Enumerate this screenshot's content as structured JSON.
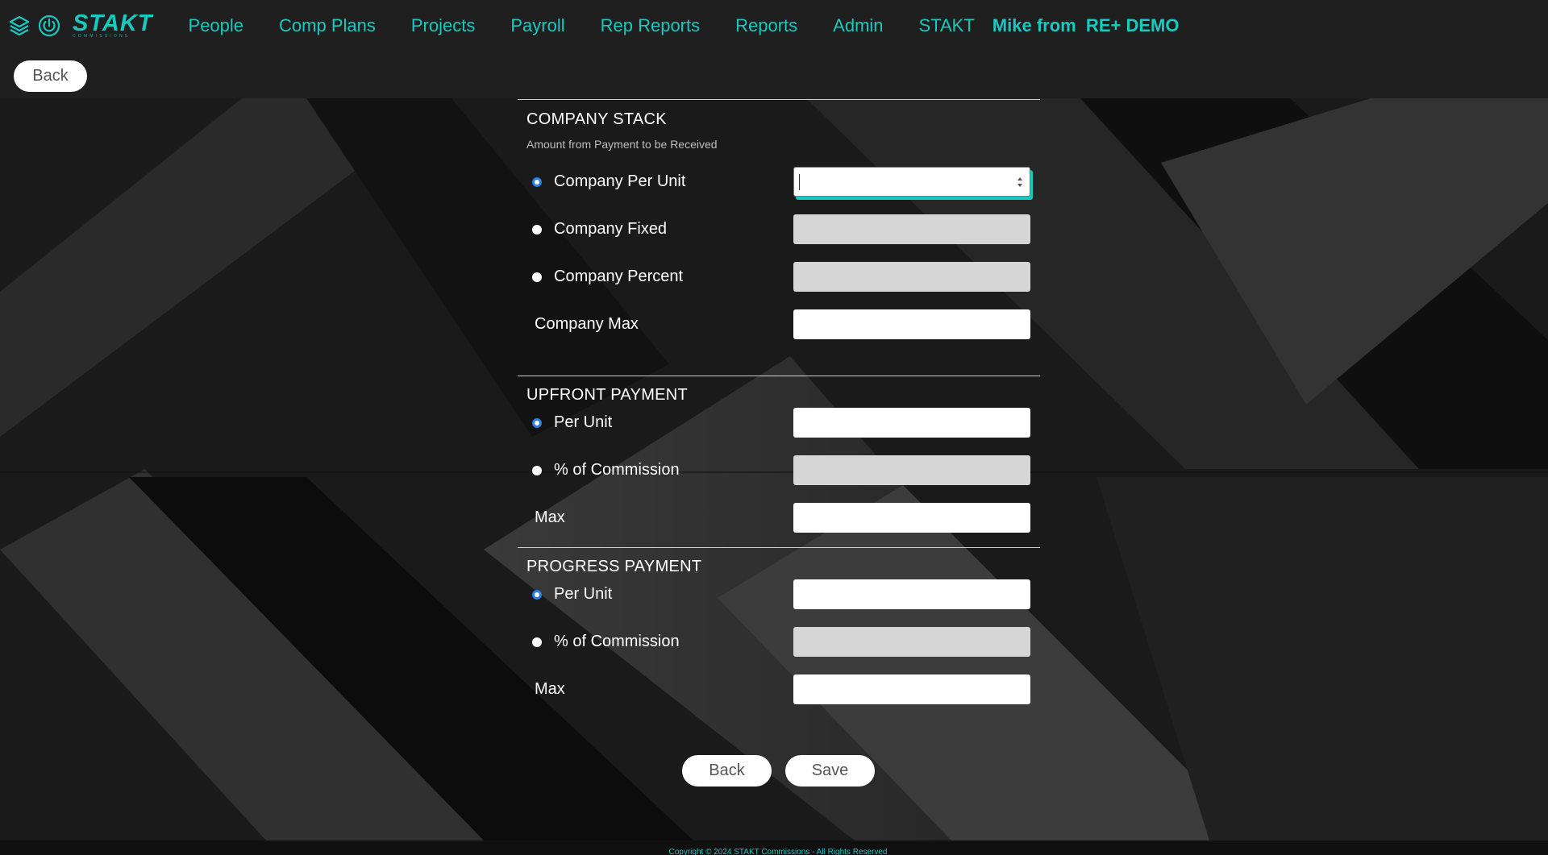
{
  "nav": {
    "brand_name": "STAKT",
    "brand_sub": "COMMISSIONS",
    "items": [
      {
        "label": "People"
      },
      {
        "label": "Comp Plans"
      },
      {
        "label": "Projects"
      },
      {
        "label": "Payroll"
      },
      {
        "label": "Rep Reports"
      },
      {
        "label": "Reports"
      },
      {
        "label": "Admin"
      },
      {
        "label": "STAKT"
      }
    ],
    "user_label": "Mike from  RE+ DEMO"
  },
  "top_back_label": "Back",
  "company_stack": {
    "title": "COMPANY STACK",
    "subtitle": "Amount from Payment to be Received",
    "rows": [
      {
        "label": "Company Per Unit",
        "selected": true,
        "value": ""
      },
      {
        "label": "Company Fixed",
        "selected": false,
        "value": ""
      },
      {
        "label": "Company Percent",
        "selected": false,
        "value": ""
      }
    ],
    "max_label": "Company Max",
    "max_value": ""
  },
  "upfront_payment": {
    "title": "UPFRONT PAYMENT",
    "rows": [
      {
        "label": "Per Unit",
        "selected": true,
        "value": ""
      },
      {
        "label": "% of Commission",
        "selected": false,
        "value": ""
      }
    ],
    "max_label": "Max",
    "max_value": ""
  },
  "progress_payment": {
    "title": "PROGRESS PAYMENT",
    "rows": [
      {
        "label": "Per Unit",
        "selected": true,
        "value": ""
      },
      {
        "label": "% of Commission",
        "selected": false,
        "value": ""
      }
    ],
    "max_label": "Max",
    "max_value": ""
  },
  "actions": {
    "back_label": "Back",
    "save_label": "Save"
  },
  "footer": {
    "copyright": "Copyright © 2024 STAKT Commissions - All Rights Reserved"
  },
  "colors": {
    "accent": "#19c9bf",
    "radio_selected": "#2a7de1",
    "nav_bg": "#1f1f1f"
  }
}
